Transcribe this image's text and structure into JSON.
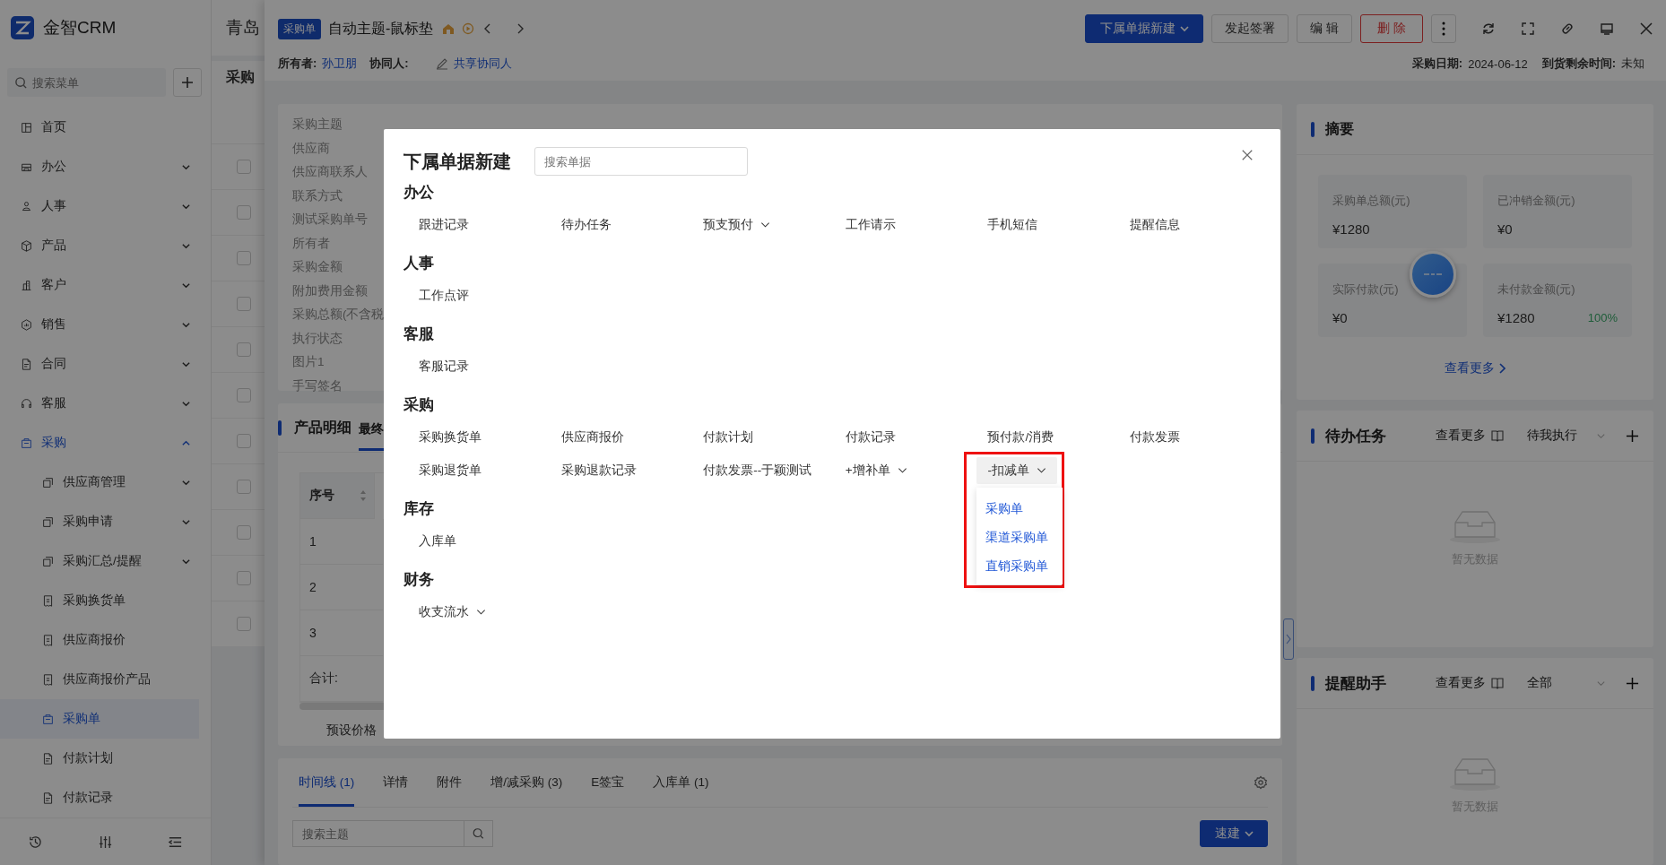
{
  "app": {
    "name": "金智CRM"
  },
  "sidebar": {
    "search": {
      "placeholder": "搜索菜单"
    },
    "items": [
      {
        "label": "首页",
        "expandable": false,
        "selected": false
      },
      {
        "label": "办公",
        "expandable": true,
        "expanded": false,
        "selected": false
      },
      {
        "label": "人事",
        "expandable": true,
        "expanded": false,
        "selected": false
      },
      {
        "label": "产品",
        "expandable": true,
        "expanded": false,
        "selected": false
      },
      {
        "label": "客户",
        "expandable": true,
        "expanded": false,
        "selected": false
      },
      {
        "label": "销售",
        "expandable": true,
        "expanded": false,
        "selected": false
      },
      {
        "label": "合同",
        "expandable": true,
        "expanded": false,
        "selected": false
      },
      {
        "label": "客服",
        "expandable": true,
        "expanded": false,
        "selected": false
      },
      {
        "label": "采购",
        "expandable": true,
        "expanded": true,
        "selected": true,
        "children": [
          {
            "label": "供应商管理",
            "expandable": true,
            "expanded": false,
            "selected": false
          },
          {
            "label": "采购申请",
            "expandable": true,
            "expanded": false,
            "selected": false
          },
          {
            "label": "采购汇总/提醒",
            "expandable": true,
            "expanded": false,
            "selected": false
          },
          {
            "label": "采购换货单",
            "expandable": false,
            "selected": false
          },
          {
            "label": "供应商报价",
            "expandable": false,
            "selected": false
          },
          {
            "label": "供应商报价产品",
            "expandable": false,
            "selected": false
          },
          {
            "label": "采购单",
            "expandable": false,
            "selected": true
          },
          {
            "label": "付款计划",
            "expandable": false,
            "selected": false
          },
          {
            "label": "付款记录",
            "expandable": false,
            "selected": false
          }
        ]
      }
    ]
  },
  "background_page": {
    "title": "青岛",
    "heading": "采购",
    "rows": [
      {
        "checked": false
      },
      {
        "checked": false
      },
      {
        "checked": false
      },
      {
        "checked": false
      },
      {
        "checked": false
      },
      {
        "checked": false
      },
      {
        "checked": false
      },
      {
        "checked": false
      },
      {
        "checked": false
      },
      {
        "checked": false
      },
      {
        "checked": false
      }
    ]
  },
  "record": {
    "tag": "采购单",
    "title": "自动主题-鼠标垫",
    "actions": [
      {
        "label": "下属单据新建",
        "kind": "primary"
      },
      {
        "label": "发起签署",
        "kind": "default"
      },
      {
        "label": "编 辑",
        "kind": "default"
      },
      {
        "label": "删 除",
        "kind": "danger"
      }
    ],
    "owner_label": "所有者:",
    "owner": "孙卫朋",
    "collaborator_label": "协同人:",
    "share_link": "共享协同人",
    "meta": [
      {
        "label": "采购日期:",
        "value": "2024-06-12"
      },
      {
        "label": "到货剩余时间:",
        "value": "未知"
      }
    ]
  },
  "fields": [
    "采购主题",
    "供应商",
    "供应商联系人",
    "联系方式",
    "测试采购单号",
    "所有者",
    "采购金额",
    "附加费用金额",
    "采购总额(不含税",
    "执行状态",
    "图片1",
    "手写签名"
  ],
  "products": {
    "title": "产品明细",
    "tabs": [
      {
        "label": "最终",
        "selected": true
      }
    ],
    "columns": [
      "序号"
    ],
    "rows": [
      "1",
      "2",
      "3"
    ],
    "total_label": "合计:",
    "summary_text": "预设价格"
  },
  "bottom_tabs": [
    {
      "label": "时间线 (1)",
      "selected": true
    },
    {
      "label": "详情",
      "selected": false
    },
    {
      "label": "附件",
      "selected": false
    },
    {
      "label": "增/减采购 (3)",
      "selected": false
    },
    {
      "label": "E签宝",
      "selected": false
    },
    {
      "label": "入库单 (1)",
      "selected": false
    }
  ],
  "timeline": {
    "search": {
      "placeholder": "搜索主题"
    },
    "quick_create": "速建"
  },
  "summary": {
    "title": "摘要",
    "stats": [
      {
        "label": "采购单总额(元)",
        "value": "¥1280"
      },
      {
        "label": "已冲销金额(元)",
        "value": "¥0"
      },
      {
        "label": "实际付款(元)",
        "value": "¥0"
      },
      {
        "label": "未付款金额(元)",
        "value": "¥1280",
        "percent": "100%"
      }
    ],
    "more": "查看更多"
  },
  "panels": [
    {
      "title": "待办任务",
      "more": "查看更多",
      "filter": "待我执行",
      "empty": "暂无数据"
    },
    {
      "title": "提醒助手",
      "more": "查看更多",
      "filter": "全部",
      "empty": "暂无数据"
    }
  ],
  "dialog": {
    "title": "下属单据新建",
    "search": {
      "placeholder": "搜索单据"
    },
    "groups": [
      {
        "name": "办公",
        "items": [
          {
            "label": "跟进记录",
            "kind": "link"
          },
          {
            "label": "待办任务",
            "kind": "link"
          },
          {
            "label": "预支预付",
            "kind": "dropdown",
            "expanded": false
          },
          {
            "label": "工作请示",
            "kind": "link"
          },
          {
            "label": "手机短信",
            "kind": "link"
          },
          {
            "label": "提醒信息",
            "kind": "link"
          }
        ]
      },
      {
        "name": "人事",
        "items": [
          {
            "label": "工作点评",
            "kind": "link"
          }
        ]
      },
      {
        "name": "客服",
        "items": [
          {
            "label": "客服记录",
            "kind": "link"
          }
        ]
      },
      {
        "name": "采购",
        "items": [
          {
            "label": "采购换货单",
            "kind": "link"
          },
          {
            "label": "供应商报价",
            "kind": "link"
          },
          {
            "label": "付款计划",
            "kind": "link"
          },
          {
            "label": "付款记录",
            "kind": "link"
          },
          {
            "label": "预付款/消费",
            "kind": "link"
          },
          {
            "label": "付款发票",
            "kind": "link"
          },
          {
            "label": "采购退货单",
            "kind": "link"
          },
          {
            "label": "采购退款记录",
            "kind": "link"
          },
          {
            "label": "付款发票--于颖测试",
            "kind": "link"
          },
          {
            "label": "+增补单",
            "kind": "dropdown",
            "expanded": false
          },
          {
            "label": "-扣减单",
            "kind": "dropdown",
            "expanded": true,
            "highlighted": true,
            "options": [
              "采购单",
              "渠道采购单",
              "直销采购单"
            ]
          }
        ]
      },
      {
        "name": "库存",
        "items": [
          {
            "label": "入库单",
            "kind": "link"
          }
        ]
      },
      {
        "name": "财务",
        "items": [
          {
            "label": "收支流水",
            "kind": "dropdown",
            "expanded": false
          }
        ]
      }
    ]
  }
}
